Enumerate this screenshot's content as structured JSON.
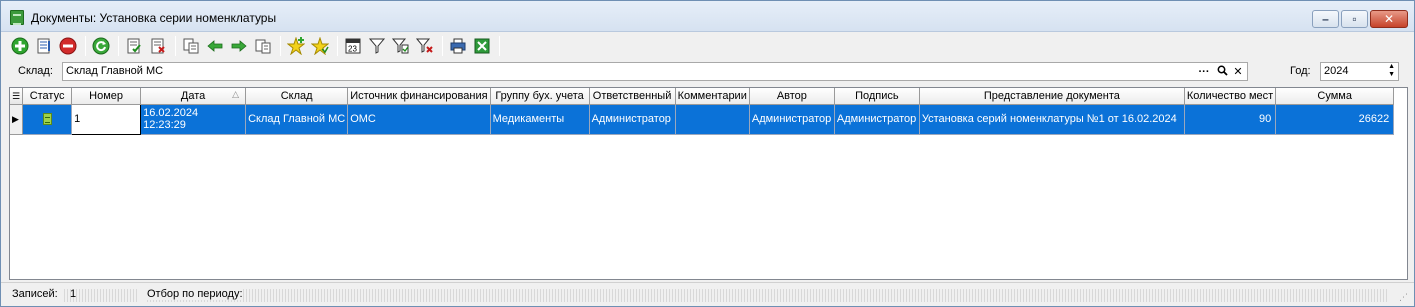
{
  "window": {
    "title": "Документы: Установка серии номенклатуры",
    "controls": [
      "minimize",
      "maximize",
      "close"
    ]
  },
  "toolbar": {
    "groups": [
      [
        "add-icon",
        "edit-icon",
        "delete-icon"
      ],
      [
        "refresh-icon"
      ],
      [
        "post-icon",
        "unpost-icon"
      ],
      [
        "copy-icon",
        "back-icon",
        "forward-icon",
        "paste-icon"
      ],
      [
        "star-add-icon",
        "star-icon"
      ],
      [
        "calendar-icon",
        "filter-icon",
        "filter-edit-icon",
        "filter-clear-icon"
      ],
      [
        "print-icon",
        "excel-icon"
      ]
    ]
  },
  "filter": {
    "warehouse_label": "Склад:",
    "warehouse_value": "Склад Главной МС",
    "year_label": "Год:",
    "year_value": "2024"
  },
  "grid": {
    "columns": [
      {
        "key": "status",
        "label": "Статус"
      },
      {
        "key": "number",
        "label": "Номер"
      },
      {
        "key": "date",
        "label": "Дата"
      },
      {
        "key": "warehouse",
        "label": "Склад"
      },
      {
        "key": "funding",
        "label": "Источник финансирования"
      },
      {
        "key": "accounting_group",
        "label": "Группу бух. учета"
      },
      {
        "key": "responsible",
        "label": "Ответственный"
      },
      {
        "key": "comments",
        "label": "Комментарии"
      },
      {
        "key": "author",
        "label": "Автор"
      },
      {
        "key": "signature",
        "label": "Подпись"
      },
      {
        "key": "representation",
        "label": "Представление документа"
      },
      {
        "key": "places",
        "label": "Количество мест"
      },
      {
        "key": "sum",
        "label": "Сумма"
      }
    ],
    "rows": [
      {
        "status": "document-icon",
        "number": "1",
        "date_line1": "16.02.2024",
        "date_line2": "12:23:29",
        "warehouse": "Склад Главной МС",
        "funding": "ОМС",
        "accounting_group": "Медикаменты",
        "responsible": "Администратор",
        "comments": "",
        "author": "Администратор",
        "signature": "Администратор",
        "representation": "Установка серий номенклатуры №1 от 16.02.2024",
        "places": "90",
        "sum": "26622"
      }
    ]
  },
  "status": {
    "records_label": "Записей:",
    "records_value": "1",
    "period_label": "Отбор по периоду:"
  },
  "colors": {
    "selection": "#0b72d8",
    "titlebar": "#dbe6f4"
  }
}
